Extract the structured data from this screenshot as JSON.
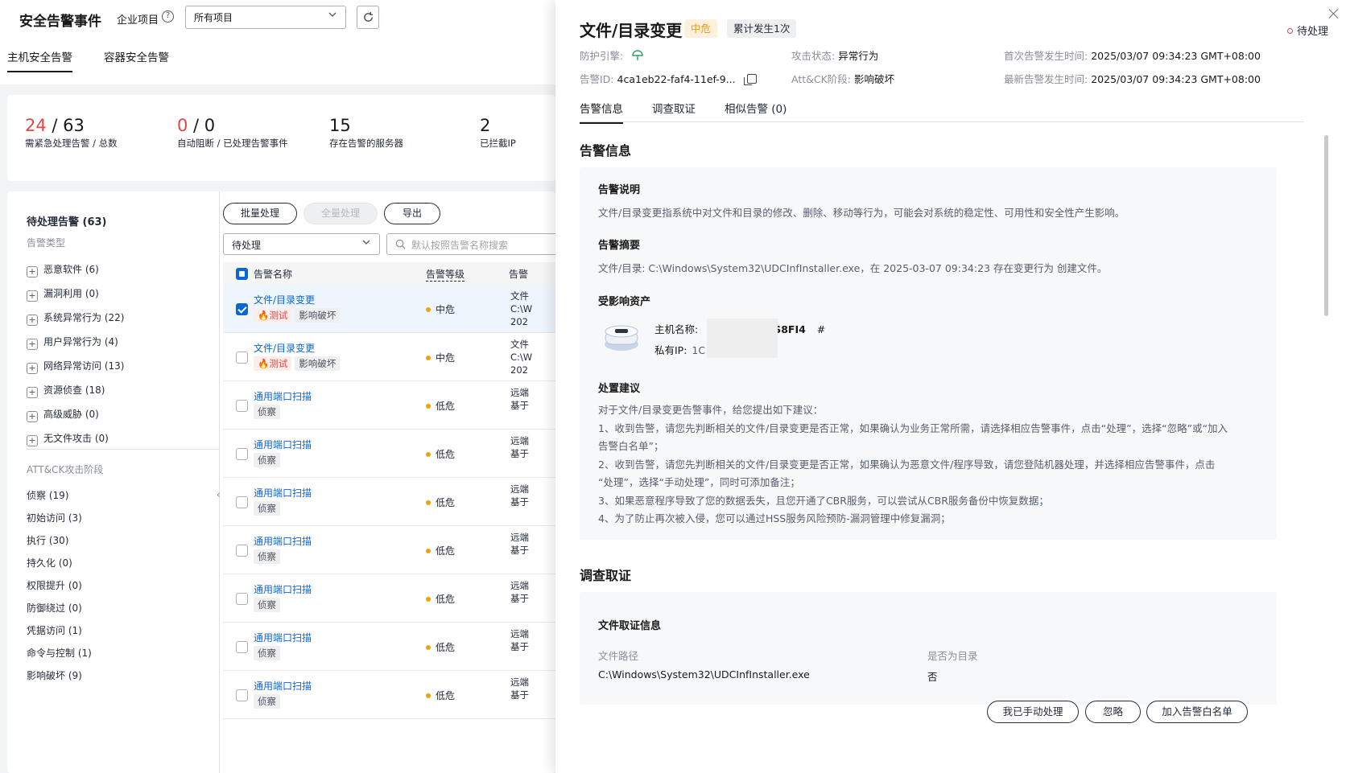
{
  "bg": {
    "page_title": "安全告警事件",
    "enterprise_label": "企业项目",
    "project_select": "所有项目",
    "tabs": [
      {
        "label": "主机安全告警"
      },
      {
        "label": "容器安全告警"
      }
    ],
    "stats": [
      {
        "red": "24",
        "rest": " / 63",
        "label": "需紧急处理告警 / 总数"
      },
      {
        "red": "0",
        "rest": " / 0",
        "label": "自动阻断 / 已处理告警事件"
      },
      {
        "red": "",
        "rest": "15",
        "label": "存在告警的服务器"
      },
      {
        "red": "",
        "rest": "2",
        "label": "已拦截IP"
      }
    ],
    "filter": {
      "pending_title": "待处理告警 (63)",
      "type_label": "告警类型",
      "types": [
        {
          "label": "恶意软件 (6)"
        },
        {
          "label": "漏洞利用 (0)"
        },
        {
          "label": "系统异常行为 (22)"
        },
        {
          "label": "用户异常行为 (4)"
        },
        {
          "label": "网络异常访问 (13)"
        },
        {
          "label": "资源侦查 (18)"
        },
        {
          "label": "高级威胁 (0)"
        },
        {
          "label": "无文件攻击 (0)"
        }
      ],
      "phase_label": "ATT&CK攻击阶段",
      "phases": [
        {
          "label": "侦察 (19)"
        },
        {
          "label": "初始访问 (3)"
        },
        {
          "label": "执行 (30)"
        },
        {
          "label": "持久化 (0)"
        },
        {
          "label": "权限提升 (0)"
        },
        {
          "label": "防御绕过 (0)"
        },
        {
          "label": "凭据访问 (1)"
        },
        {
          "label": "命令与控制 (1)"
        },
        {
          "label": "影响破坏 (9)"
        }
      ]
    },
    "list": {
      "batch_btn": "批量处理",
      "all_btn": "全量处理",
      "export_btn": "导出",
      "status_select": "待处理",
      "search_placeholder": "默认按照告警名称搜索",
      "col_name": "告警名称",
      "col_level": "告警等级",
      "col_desc": "告警",
      "rows": [
        {
          "name": "文件/目录变更",
          "tags": [
            "测试",
            "影响破坏"
          ],
          "level": "中危",
          "clip": [
            "文件",
            "C:\\W",
            "202"
          ],
          "selected": true
        },
        {
          "name": "文件/目录变更",
          "tags": [
            "测试",
            "影响破坏"
          ],
          "level": "中危",
          "clip": [
            "文件",
            "C:\\W",
            "202"
          ],
          "selected": false
        },
        {
          "name": "通用端口扫描",
          "tags": [
            "侦察"
          ],
          "level": "低危",
          "clip": [
            "远端",
            "基于"
          ],
          "selected": false
        },
        {
          "name": "通用端口扫描",
          "tags": [
            "侦察"
          ],
          "level": "低危",
          "clip": [
            "远端",
            "基于"
          ],
          "selected": false
        },
        {
          "name": "通用端口扫描",
          "tags": [
            "侦察"
          ],
          "level": "低危",
          "clip": [
            "远端",
            "基于"
          ],
          "selected": false
        },
        {
          "name": "通用端口扫描",
          "tags": [
            "侦察"
          ],
          "level": "低危",
          "clip": [
            "远端",
            "基于"
          ],
          "selected": false
        },
        {
          "name": "通用端口扫描",
          "tags": [
            "侦察"
          ],
          "level": "低危",
          "clip": [
            "远端",
            "基于"
          ],
          "selected": false
        },
        {
          "name": "通用端口扫描",
          "tags": [
            "侦察"
          ],
          "level": "低危",
          "clip": [
            "远端",
            "基于"
          ],
          "selected": false
        },
        {
          "name": "通用端口扫描",
          "tags": [
            "侦察"
          ],
          "level": "低危",
          "clip": [
            "远端",
            "基于"
          ],
          "selected": false
        }
      ]
    }
  },
  "drawer": {
    "title": "文件/目录变更",
    "severity": "中危",
    "count": "累计发生1次",
    "status": "待处理",
    "meta": {
      "engine_label": "防护引擎:",
      "alert_id_label": "告警ID:",
      "alert_id": "4ca1eb22-faf4-11ef-9...",
      "attack_state_label": "攻击状态:",
      "attack_state": "异常行为",
      "attck_label": "Att&CK阶段:",
      "attck": "影响破坏",
      "first_time_label": "首次告警发生时间:",
      "first_time": "2025/03/07 09:34:23 GMT+08:00",
      "last_time_label": "最新告警发生时间:",
      "last_time": "2025/03/07 09:34:23 GMT+08:00"
    },
    "tabs": [
      {
        "label": "告警信息"
      },
      {
        "label": "调查取证"
      },
      {
        "label": "相似告警 (0)"
      }
    ],
    "info": {
      "section_title": "告警信息",
      "desc_title": "告警说明",
      "desc": "文件/目录变更指系统中对文件和目录的修改、删除、移动等行为，可能会对系统的稳定性、可用性和安全性产生影响。",
      "summary_title": "告警摘要",
      "summary": "文件/目录: C:\\Windows\\System32\\UDCInfInstaller.exe，在 2025-03-07 09:34:23 存在变更行为 创建文件。",
      "asset_title": "受影响资产",
      "host_label": "主机名称:",
      "host_value": "S8FI4",
      "host_hash": "#",
      "ip_label": "私有IP:",
      "ip_value": "1C",
      "advice_title": "处置建议",
      "advice": [
        "对于文件/目录变更告警事件，给您提出如下建议：",
        "1、收到告警，请您先判断相关的文件/目录变更是否正常，如果确认为业务正常所需，请选择相应告警事件，点击“处理”，选择“忽略”或“加入",
        "告警白名单”；",
        "2、收到告警，请您先判断相关的文件/目录变更是否正常，如果确认为恶意文件/程序导致，请您登陆机器处理，并选择相应告警事件，点击",
        "“处理”，选择“手动处理”，同时可添加备注；",
        "3、如果恶意程序导致了您的数据丢失，且您开通了CBR服务，可以尝试从CBR服务备份中恢复数据；",
        "4、为了防止再次被入侵，您可以通过HSS服务风险预防-漏洞管理中修复漏洞；"
      ]
    },
    "forensics": {
      "section_title": "调查取证",
      "file_title": "文件取证信息",
      "path_label": "文件路径",
      "path_value": "C:\\Windows\\System32\\UDCInfInstaller.exe",
      "dir_label": "是否为目录",
      "dir_value": "否"
    },
    "footer": {
      "manual_btn": "我已手动处理",
      "ignore_btn": "忽略",
      "whitelist_btn": "加入告警白名单"
    }
  },
  "colors": {
    "accent": "#0a66d6",
    "danger": "#e54545",
    "warning": "#e69a11"
  }
}
